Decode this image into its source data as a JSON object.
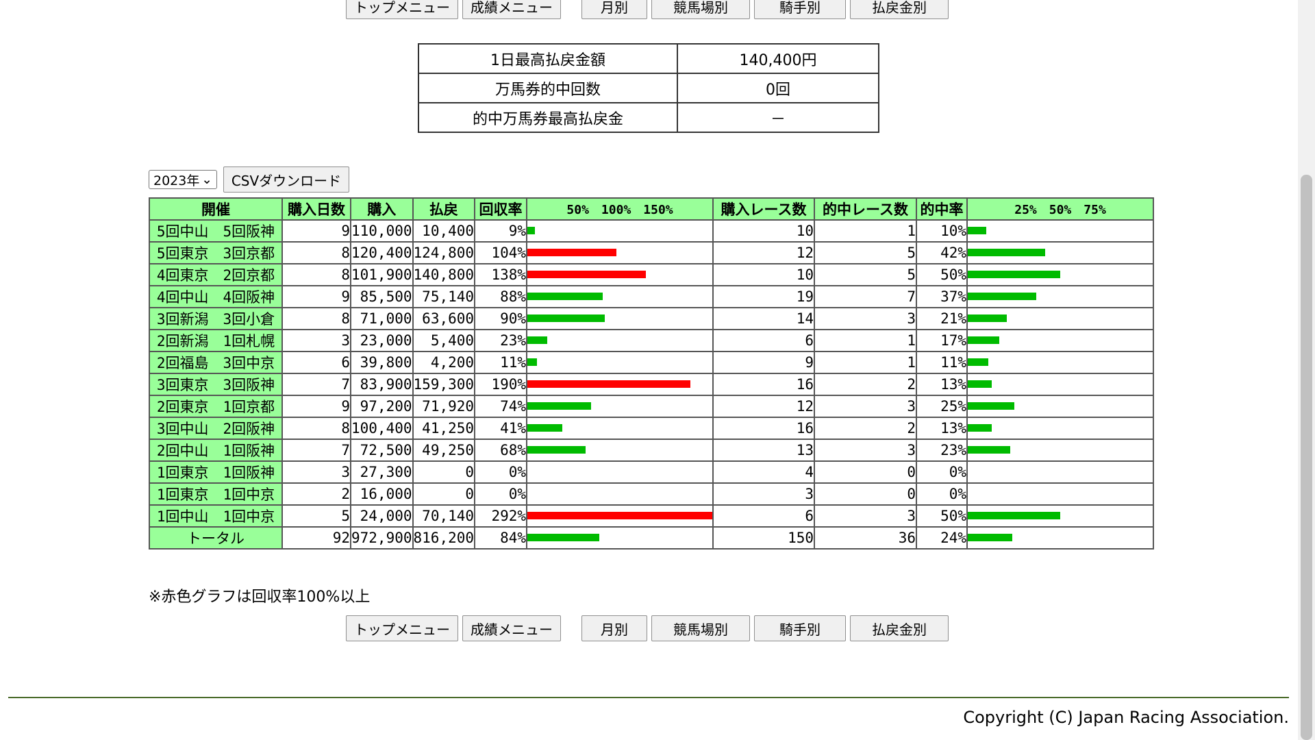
{
  "nav": [
    "トップメニュー",
    "成績メニュー",
    "月別",
    "競馬場別",
    "騎手別",
    "払戻金別"
  ],
  "summary": [
    {
      "label": "1日最高払戻金額",
      "value": "140,400円"
    },
    {
      "label": "万馬券的中回数",
      "value": "0回"
    },
    {
      "label": "的中万馬券最高払戻金",
      "value": "－"
    }
  ],
  "controls": {
    "year": "2023年",
    "csv_label": "CSVダウンロード"
  },
  "table": {
    "headers": [
      "開催",
      "購入日数",
      "購入",
      "払戻",
      "回収率",
      "50%　100%　150%",
      "購入レース数",
      "的中レース数",
      "的中率",
      "25%　50%　75%"
    ],
    "rows": [
      {
        "name": "5回中山　5回阪神",
        "days": "9",
        "purchase": "110,000",
        "payout": "10,400",
        "recovery": "9%",
        "races": "10",
        "hits": "1",
        "hit_rate": "10%"
      },
      {
        "name": "5回東京　3回京都",
        "days": "8",
        "purchase": "120,400",
        "payout": "124,800",
        "recovery": "104%",
        "races": "12",
        "hits": "5",
        "hit_rate": "42%"
      },
      {
        "name": "4回東京　2回京都",
        "days": "8",
        "purchase": "101,900",
        "payout": "140,800",
        "recovery": "138%",
        "races": "10",
        "hits": "5",
        "hit_rate": "50%"
      },
      {
        "name": "4回中山　4回阪神",
        "days": "9",
        "purchase": "85,500",
        "payout": "75,140",
        "recovery": "88%",
        "races": "19",
        "hits": "7",
        "hit_rate": "37%"
      },
      {
        "name": "3回新潟　3回小倉",
        "days": "8",
        "purchase": "71,000",
        "payout": "63,600",
        "recovery": "90%",
        "races": "14",
        "hits": "3",
        "hit_rate": "21%"
      },
      {
        "name": "2回新潟　1回札幌",
        "days": "3",
        "purchase": "23,000",
        "payout": "5,400",
        "recovery": "23%",
        "races": "6",
        "hits": "1",
        "hit_rate": "17%"
      },
      {
        "name": "2回福島　3回中京",
        "days": "6",
        "purchase": "39,800",
        "payout": "4,200",
        "recovery": "11%",
        "races": "9",
        "hits": "1",
        "hit_rate": "11%"
      },
      {
        "name": "3回東京　3回阪神",
        "days": "7",
        "purchase": "83,900",
        "payout": "159,300",
        "recovery": "190%",
        "races": "16",
        "hits": "2",
        "hit_rate": "13%"
      },
      {
        "name": "2回東京　1回京都",
        "days": "9",
        "purchase": "97,200",
        "payout": "71,920",
        "recovery": "74%",
        "races": "12",
        "hits": "3",
        "hit_rate": "25%"
      },
      {
        "name": "3回中山　2回阪神",
        "days": "8",
        "purchase": "100,400",
        "payout": "41,250",
        "recovery": "41%",
        "races": "16",
        "hits": "2",
        "hit_rate": "13%"
      },
      {
        "name": "2回中山　1回阪神",
        "days": "7",
        "purchase": "72,500",
        "payout": "49,250",
        "recovery": "68%",
        "races": "13",
        "hits": "3",
        "hit_rate": "23%"
      },
      {
        "name": "1回東京　1回阪神",
        "days": "3",
        "purchase": "27,300",
        "payout": "0",
        "recovery": "0%",
        "races": "4",
        "hits": "0",
        "hit_rate": "0%"
      },
      {
        "name": "1回東京　1回中京",
        "days": "2",
        "purchase": "16,000",
        "payout": "0",
        "recovery": "0%",
        "races": "3",
        "hits": "0",
        "hit_rate": "0%"
      },
      {
        "name": "1回中山　1回中京",
        "days": "5",
        "purchase": "24,000",
        "payout": "70,140",
        "recovery": "292%",
        "races": "6",
        "hits": "3",
        "hit_rate": "50%"
      },
      {
        "name": "トータル",
        "days": "92",
        "purchase": "972,900",
        "payout": "816,200",
        "recovery": "84%",
        "races": "150",
        "hits": "36",
        "hit_rate": "24%"
      }
    ]
  },
  "colors": {
    "header_bg": "#99ff99",
    "bar_high": "#ff0000",
    "bar_normal": "#00bb00"
  },
  "note": "※赤色グラフは回収率100%以上",
  "copyright": "Copyright (C) Japan Racing Association."
}
